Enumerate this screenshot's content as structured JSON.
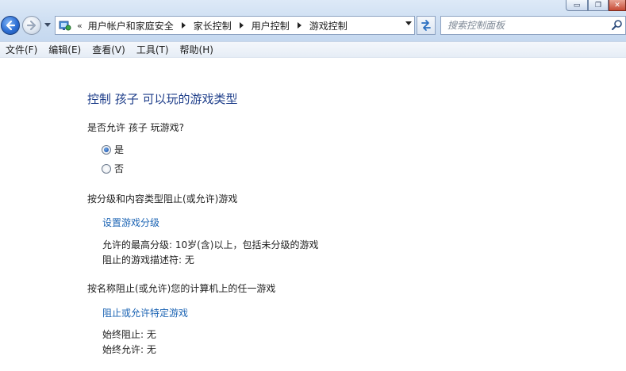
{
  "window": {
    "buttons": {
      "minimize": "▭",
      "maximize": "❐",
      "close": "✕"
    }
  },
  "nav": {
    "back_icon": "back-arrow-icon",
    "forward_icon": "forward-arrow-icon"
  },
  "address": {
    "chevron": "«",
    "crumbs": [
      "用户帐户和家庭安全",
      "家长控制",
      "用户控制",
      "游戏控制"
    ]
  },
  "search": {
    "placeholder": "搜索控制面板"
  },
  "menu": {
    "file": "文件(F)",
    "edit": "编辑(E)",
    "view": "查看(V)",
    "tools": "工具(T)",
    "help": "帮助(H)"
  },
  "page": {
    "title": "控制 孩子 可以玩的游戏类型",
    "allow_question": "是否允许 孩子 玩游戏?",
    "option_yes": "是",
    "option_no": "否",
    "selected": "yes",
    "ratings_heading": "按分级和内容类型阻止(或允许)游戏",
    "ratings_link": "设置游戏分级",
    "max_rating": "允许的最高分级:  10岁(含)以上，包括未分级的游戏",
    "blocked_descriptors": "阻止的游戏描述符: 无",
    "specific_heading": "按名称阻止(或允许)您的计算机上的任一游戏",
    "specific_link": "阻止或允许特定游戏",
    "always_block": "始终阻止: 无",
    "always_allow": "始终允许: 无"
  },
  "colors": {
    "title": "#1e3e8a",
    "link": "#1c64b4",
    "chrome": "#cddef2"
  }
}
